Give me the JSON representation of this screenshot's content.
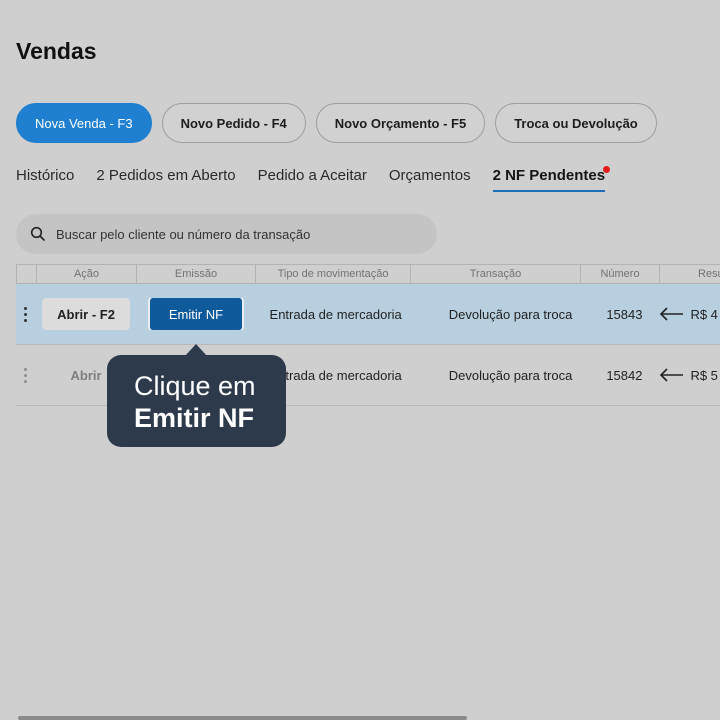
{
  "page": {
    "title": "Vendas"
  },
  "actions": [
    {
      "label": "Nova Venda - F3",
      "primary": true
    },
    {
      "label": "Novo Pedido - F4",
      "primary": false
    },
    {
      "label": "Novo Orçamento - F5",
      "primary": false
    },
    {
      "label": "Troca ou Devolução",
      "primary": false
    }
  ],
  "tabs": [
    {
      "label": "Histórico"
    },
    {
      "label": "2 Pedidos em Aberto"
    },
    {
      "label": "Pedido a Aceitar"
    },
    {
      "label": "Orçamentos"
    },
    {
      "label": "2 NF Pendentes",
      "active": true
    }
  ],
  "search": {
    "placeholder": "Buscar pelo cliente ou número da transação"
  },
  "table": {
    "headers": [
      "Ação",
      "Emissão",
      "Tipo de movimentação",
      "Transação",
      "Número",
      "Resu"
    ],
    "rows": [
      {
        "open_label": "Abrir - F2",
        "issue_label": "Emitir NF",
        "movement": "Entrada de mercadoria",
        "transaction": "Devolução para troca",
        "number": "15843",
        "amount": "R$ 4"
      },
      {
        "open_label": "Abrir",
        "issue_label": "",
        "movement": "Entrada de mercadoria",
        "transaction": "Devolução para troca",
        "number": "15842",
        "amount": "R$ 5"
      }
    ]
  },
  "tooltip": {
    "line1": "Clique em",
    "line2": "Emitir NF"
  },
  "colors": {
    "primary": "#1f7fd0",
    "selected_row": "#b8cfdf",
    "tooltip_bg": "#2c3a4c",
    "notification_dot": "#e21b1b"
  }
}
